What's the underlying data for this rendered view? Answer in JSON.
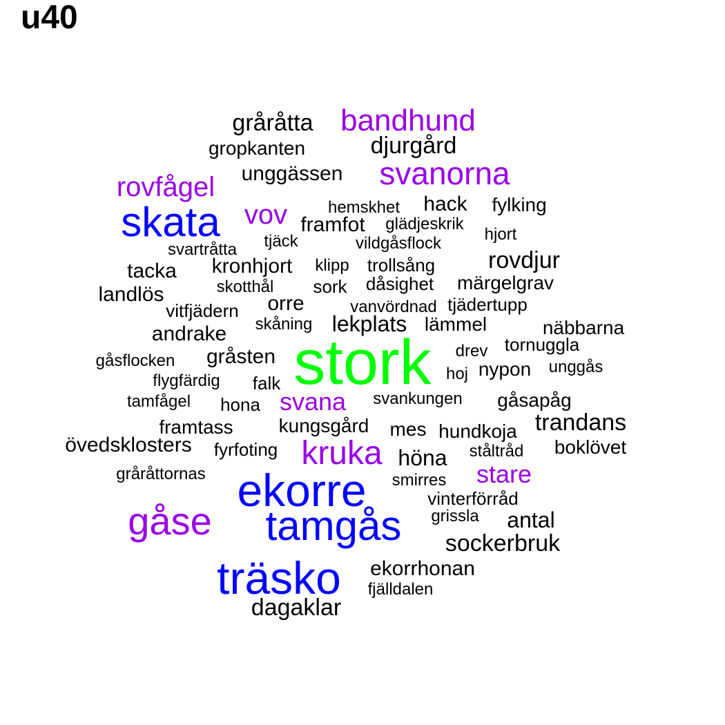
{
  "title": "u40",
  "colors": {
    "green": "#00ff00",
    "blue": "#0000ff",
    "purple": "#9900e6",
    "black": "#000000"
  },
  "words": [
    {
      "text": "stork",
      "color": "green"
    },
    {
      "text": "ekorre",
      "color": "blue"
    },
    {
      "text": "träsko",
      "color": "blue"
    },
    {
      "text": "tamgås",
      "color": "blue"
    },
    {
      "text": "skata",
      "color": "blue"
    },
    {
      "text": "gåse",
      "color": "purple"
    },
    {
      "text": "kruka",
      "color": "purple"
    },
    {
      "text": "svanorna",
      "color": "purple"
    },
    {
      "text": "bandhund",
      "color": "purple"
    },
    {
      "text": "rovfågel",
      "color": "purple"
    },
    {
      "text": "vov",
      "color": "purple"
    },
    {
      "text": "svana",
      "color": "purple"
    },
    {
      "text": "stare",
      "color": "purple"
    },
    {
      "text": "gråråtta",
      "color": "black"
    },
    {
      "text": "djurgård",
      "color": "black"
    },
    {
      "text": "gropkanten",
      "color": "black"
    },
    {
      "text": "unggässen",
      "color": "black"
    },
    {
      "text": "hemskhet",
      "color": "black"
    },
    {
      "text": "hack",
      "color": "black"
    },
    {
      "text": "fylking",
      "color": "black"
    },
    {
      "text": "framfot",
      "color": "black"
    },
    {
      "text": "glädjeskrik",
      "color": "black"
    },
    {
      "text": "hjort",
      "color": "black"
    },
    {
      "text": "tjäck",
      "color": "black"
    },
    {
      "text": "vildgåsflock",
      "color": "black"
    },
    {
      "text": "svartråtta",
      "color": "black"
    },
    {
      "text": "rovdjur",
      "color": "black"
    },
    {
      "text": "tacka",
      "color": "black"
    },
    {
      "text": "kronhjort",
      "color": "black"
    },
    {
      "text": "klipp",
      "color": "black"
    },
    {
      "text": "trollsång",
      "color": "black"
    },
    {
      "text": "märgelgrav",
      "color": "black"
    },
    {
      "text": "skotthål",
      "color": "black"
    },
    {
      "text": "sork",
      "color": "black"
    },
    {
      "text": "dåsighet",
      "color": "black"
    },
    {
      "text": "landlös",
      "color": "black"
    },
    {
      "text": "orre",
      "color": "black"
    },
    {
      "text": "vitfjädern",
      "color": "black"
    },
    {
      "text": "vanvördnad",
      "color": "black"
    },
    {
      "text": "tjädertupp",
      "color": "black"
    },
    {
      "text": "skåning",
      "color": "black"
    },
    {
      "text": "lekplats",
      "color": "black"
    },
    {
      "text": "lämmel",
      "color": "black"
    },
    {
      "text": "näbbarna",
      "color": "black"
    },
    {
      "text": "andrake",
      "color": "black"
    },
    {
      "text": "tornuggla",
      "color": "black"
    },
    {
      "text": "drev",
      "color": "black"
    },
    {
      "text": "gåsflocken",
      "color": "black"
    },
    {
      "text": "gråsten",
      "color": "black"
    },
    {
      "text": "nypon",
      "color": "black"
    },
    {
      "text": "unggås",
      "color": "black"
    },
    {
      "text": "hoj",
      "color": "black"
    },
    {
      "text": "flygfärdig",
      "color": "black"
    },
    {
      "text": "falk",
      "color": "black"
    },
    {
      "text": "tamfågel",
      "color": "black"
    },
    {
      "text": "hona",
      "color": "black"
    },
    {
      "text": "svankungen",
      "color": "black"
    },
    {
      "text": "gåsapåg",
      "color": "black"
    },
    {
      "text": "trandans",
      "color": "black"
    },
    {
      "text": "framtass",
      "color": "black"
    },
    {
      "text": "kungsgård",
      "color": "black"
    },
    {
      "text": "mes",
      "color": "black"
    },
    {
      "text": "hundkoja",
      "color": "black"
    },
    {
      "text": "övedsklosters",
      "color": "black"
    },
    {
      "text": "fyrfoting",
      "color": "black"
    },
    {
      "text": "ståltråd",
      "color": "black"
    },
    {
      "text": "boklövet",
      "color": "black"
    },
    {
      "text": "höna",
      "color": "black"
    },
    {
      "text": "gråråttornas",
      "color": "black"
    },
    {
      "text": "smirres",
      "color": "black"
    },
    {
      "text": "vinterförråd",
      "color": "black"
    },
    {
      "text": "grissla",
      "color": "black"
    },
    {
      "text": "antal",
      "color": "black"
    },
    {
      "text": "sockerbruk",
      "color": "black"
    },
    {
      "text": "ekorrhonan",
      "color": "black"
    },
    {
      "text": "fjälldalen",
      "color": "black"
    },
    {
      "text": "dagaklar",
      "color": "black"
    }
  ]
}
